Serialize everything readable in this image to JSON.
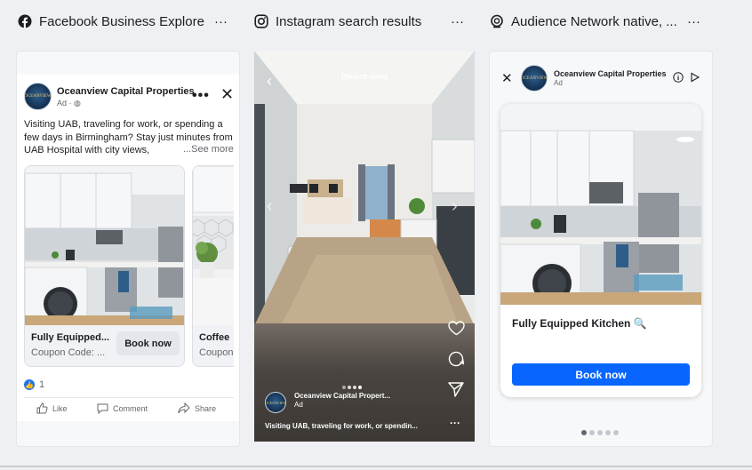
{
  "headers": [
    {
      "title": "Facebook Business Explore",
      "more": "···"
    },
    {
      "title": "Instagram search results",
      "more": "···"
    },
    {
      "title": "Audience Network native, ...",
      "more": "···"
    }
  ],
  "advertiser": {
    "name": "Oceanview Capital Properties",
    "logo_text": "OCEANVIEW",
    "ad_label": "Ad"
  },
  "facebook": {
    "sub": "Ad · ",
    "text": "Visiting UAB, traveling for work, or spending a few days in Birmingham? Stay just minutes from UAB Hospital with city views,",
    "see_more": "...See more",
    "cards": [
      {
        "title": "Fully Equipped...",
        "sub": "Coupon Code: ...",
        "button": "Book now"
      },
      {
        "title": "Coffee",
        "sub": "Coupon"
      }
    ],
    "reaction_count": "1",
    "actions": [
      "Like",
      "Comment",
      "Share"
    ]
  },
  "instagram": {
    "search_term": "[Search term]",
    "name": "Oceanview Capital Propert...",
    "ad_label": "Ad",
    "caption": "Visiting UAB, traveling for work, or spendin...",
    "more": "···"
  },
  "audience_network": {
    "name": "Oceanview Capital Properties",
    "ad_label": "Ad",
    "headline": "Fully Equipped Kitchen",
    "button": "Book now"
  },
  "colors": {
    "accent": "#0866ff",
    "facebook_blue": "#1877f2"
  }
}
